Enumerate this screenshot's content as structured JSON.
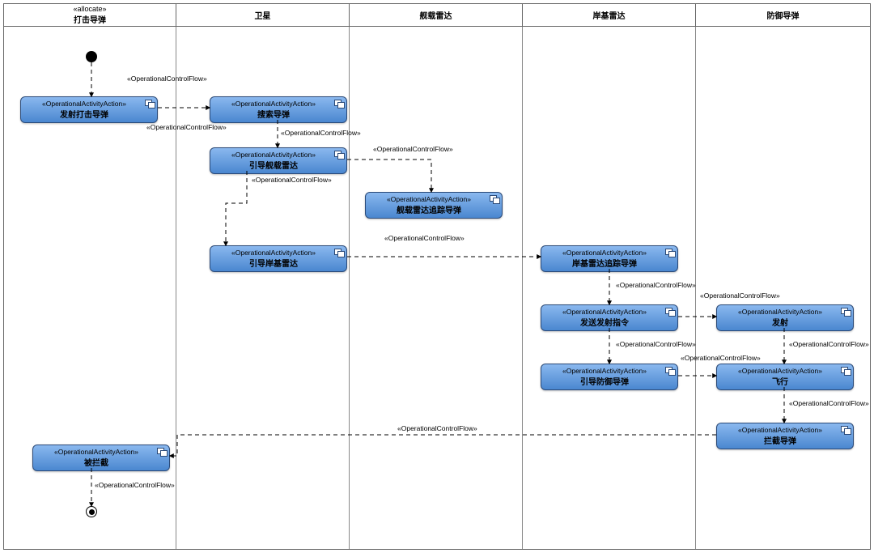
{
  "swimlanes": [
    {
      "key": "lane1",
      "stereo": "«allocate»",
      "title": "打击导弹"
    },
    {
      "key": "lane2",
      "stereo": "",
      "title": "卫星"
    },
    {
      "key": "lane3",
      "stereo": "",
      "title": "舰载雷达"
    },
    {
      "key": "lane4",
      "stereo": "",
      "title": "岸基雷达"
    },
    {
      "key": "lane5",
      "stereo": "",
      "title": "防御导弹"
    }
  ],
  "stereo_action": "«OperationalActivityAction»",
  "flow_label": "«OperationalControlFlow»",
  "actions": {
    "a1": {
      "label": "发射打击导弹"
    },
    "a2": {
      "label": "搜索导弹"
    },
    "a3": {
      "label": "引导舰载雷达"
    },
    "a4": {
      "label": "舰载雷达追踪导弹"
    },
    "a5": {
      "label": "引导岸基雷达"
    },
    "a6": {
      "label": "岸基雷达追踪导弹"
    },
    "a7": {
      "label": "发送发射指令"
    },
    "a8": {
      "label": "发射"
    },
    "a9": {
      "label": "引导防御导弹"
    },
    "a10": {
      "label": "飞行"
    },
    "a11": {
      "label": "拦截导弹"
    },
    "a12": {
      "label": "被拦截"
    }
  }
}
